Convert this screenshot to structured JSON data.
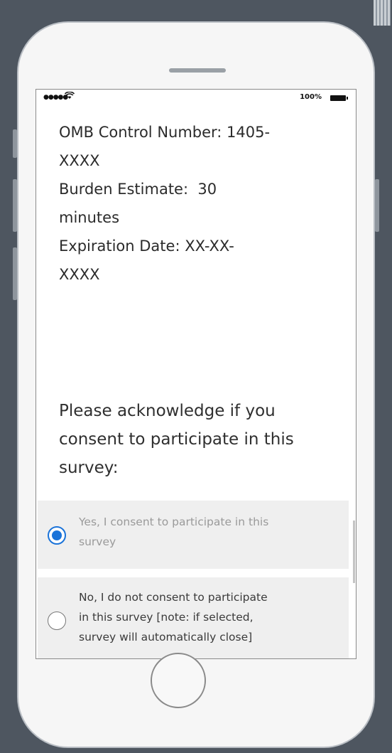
{
  "status_bar": {
    "signal": "●●●●●",
    "wifi_icon": "wifi-icon",
    "battery_percent": "100%"
  },
  "info": {
    "lines": [
      "OMB Control Number: 1405-",
      "XXXX",
      "Burden Estimate:  30",
      "minutes",
      "Expiration Date: XX-XX-",
      "XXXX"
    ]
  },
  "question": {
    "lines": [
      "Please acknowledge if you",
      "consent to participate in this",
      "survey:"
    ]
  },
  "options": [
    {
      "lines": [
        "Yes, I consent to participate in this",
        "survey"
      ],
      "selected": true
    },
    {
      "lines": [
        "No, I do not consent to participate",
        "in this survey [note: if selected,",
        "survey will automatically close]"
      ],
      "selected": false
    }
  ],
  "colors": {
    "accent": "#1a73d9",
    "background": "#4e5660"
  }
}
